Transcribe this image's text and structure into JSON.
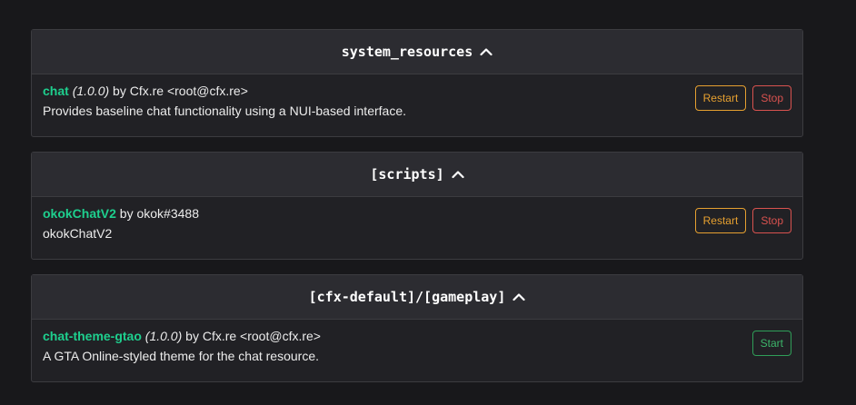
{
  "groups": [
    {
      "title": "system_resources",
      "resources": [
        {
          "name": "chat",
          "version": "(1.0.0)",
          "by": " by Cfx.re <root@cfx.re>",
          "description": "Provides baseline chat functionality using a NUI-based interface.",
          "actions": [
            "Restart",
            "Stop"
          ]
        }
      ]
    },
    {
      "title": "[scripts]",
      "resources": [
        {
          "name": "okokChatV2",
          "version": "",
          "by": " by okok#3488",
          "description": "okokChatV2",
          "actions": [
            "Restart",
            "Stop"
          ]
        }
      ]
    },
    {
      "title": "[cfx-default]/[gameplay]",
      "resources": [
        {
          "name": "chat-theme-gtao",
          "version": "(1.0.0)",
          "by": " by Cfx.re <root@cfx.re>",
          "description": "A GTA Online-styled theme for the chat resource.",
          "actions": [
            "Start"
          ]
        }
      ]
    }
  ],
  "icons": {
    "group_toggle": "chevron-up-icon"
  },
  "colors": {
    "background": "#18181b",
    "panel": "#212125",
    "header": "#2c2c31",
    "resource_name": "#1ecf8e",
    "restart": "#e6a030",
    "stop": "#d9524f",
    "start": "#3cb56a"
  }
}
